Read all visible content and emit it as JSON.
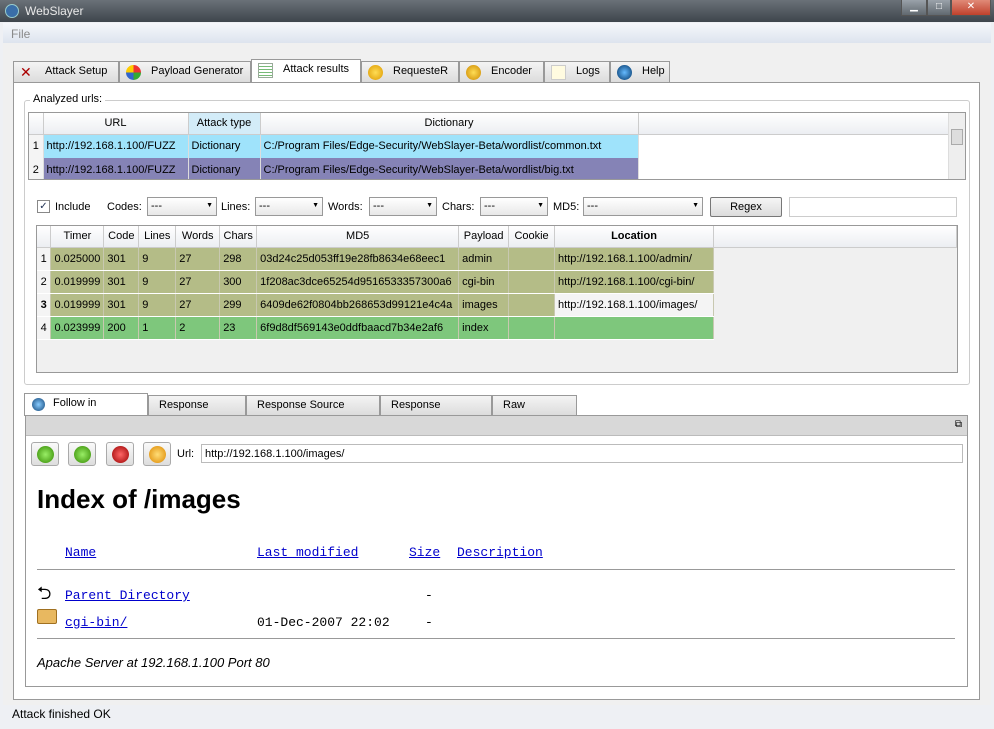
{
  "window": {
    "title": "WebSlayer"
  },
  "menu": {
    "file": "File"
  },
  "tabs": [
    {
      "label": "Attack Setup",
      "icon": "attack-setup-icon"
    },
    {
      "label": "Payload Generator",
      "icon": "payload-icon"
    },
    {
      "label": "Attack results",
      "icon": "list-icon"
    },
    {
      "label": "RequesteR",
      "icon": "requester-icon"
    },
    {
      "label": "Encoder",
      "icon": "encoder-icon"
    },
    {
      "label": "Logs",
      "icon": "logs-icon"
    },
    {
      "label": "Help",
      "icon": "info-icon"
    }
  ],
  "analyzed": {
    "label": "Analyzed urls:",
    "headers": [
      "URL",
      "Attack type",
      "Dictionary"
    ],
    "rows": [
      {
        "n": "1",
        "url": "http://192.168.1.100/FUZZ",
        "type": "Dictionary",
        "dict": "C:/Program Files/Edge-Security/WebSlayer-Beta/wordlist/common.txt"
      },
      {
        "n": "2",
        "url": "http://192.168.1.100/FUZZ",
        "type": "Dictionary",
        "dict": "C:/Program Files/Edge-Security/WebSlayer-Beta/wordlist/big.txt"
      }
    ]
  },
  "filters": {
    "include": "Include",
    "include_checked": true,
    "codes": "Codes:",
    "lines": "Lines:",
    "words": "Words:",
    "chars": "Chars:",
    "md5": "MD5:",
    "value": "---",
    "regex": "Regex",
    "regex_value": ""
  },
  "results": {
    "headers": [
      "Timer",
      "Code",
      "Lines",
      "Words",
      "Chars",
      "MD5",
      "Payload",
      "Cookie",
      "Location"
    ],
    "rows": [
      {
        "n": "1",
        "c": [
          "0.025000",
          "301",
          "9",
          "27",
          "298",
          "03d24c25d053ff19e28fb8634e68eec1",
          "admin",
          "",
          "http://192.168.1.100/admin/"
        ]
      },
      {
        "n": "2",
        "c": [
          "0.019999",
          "301",
          "9",
          "27",
          "300",
          "1f208ac3dce65254d9516533357300a6",
          "cgi-bin",
          "",
          "http://192.168.1.100/cgi-bin/"
        ]
      },
      {
        "n": "3",
        "c": [
          "0.019999",
          "301",
          "9",
          "27",
          "299",
          "6409de62f0804bb268653d99121e4c4a",
          "images",
          "",
          "http://192.168.1.100/images/"
        ]
      },
      {
        "n": "4",
        "c": [
          "0.023999",
          "200",
          "1",
          "2",
          "23",
          "6f9d8df569143e0ddfbaacd7b34e2af6",
          "index",
          "",
          ""
        ]
      }
    ]
  },
  "bottom_tabs": [
    "Follow in Browser",
    "Response HTML",
    "Response Source Code",
    "Response Headers",
    "Raw Request"
  ],
  "browser": {
    "url_label": "Url:",
    "url": "http://192.168.1.100/images/",
    "heading": "Index of /images",
    "cols": [
      "Name",
      "Last modified",
      "Size",
      "Description"
    ],
    "entries": [
      {
        "name": "Parent Directory",
        "date": "",
        "size": "-"
      },
      {
        "name": "cgi-bin/",
        "date": "01-Dec-2007 22:02",
        "size": "-"
      }
    ],
    "footer": "Apache Server at 192.168.1.100 Port 80"
  },
  "status": "Attack finished OK"
}
